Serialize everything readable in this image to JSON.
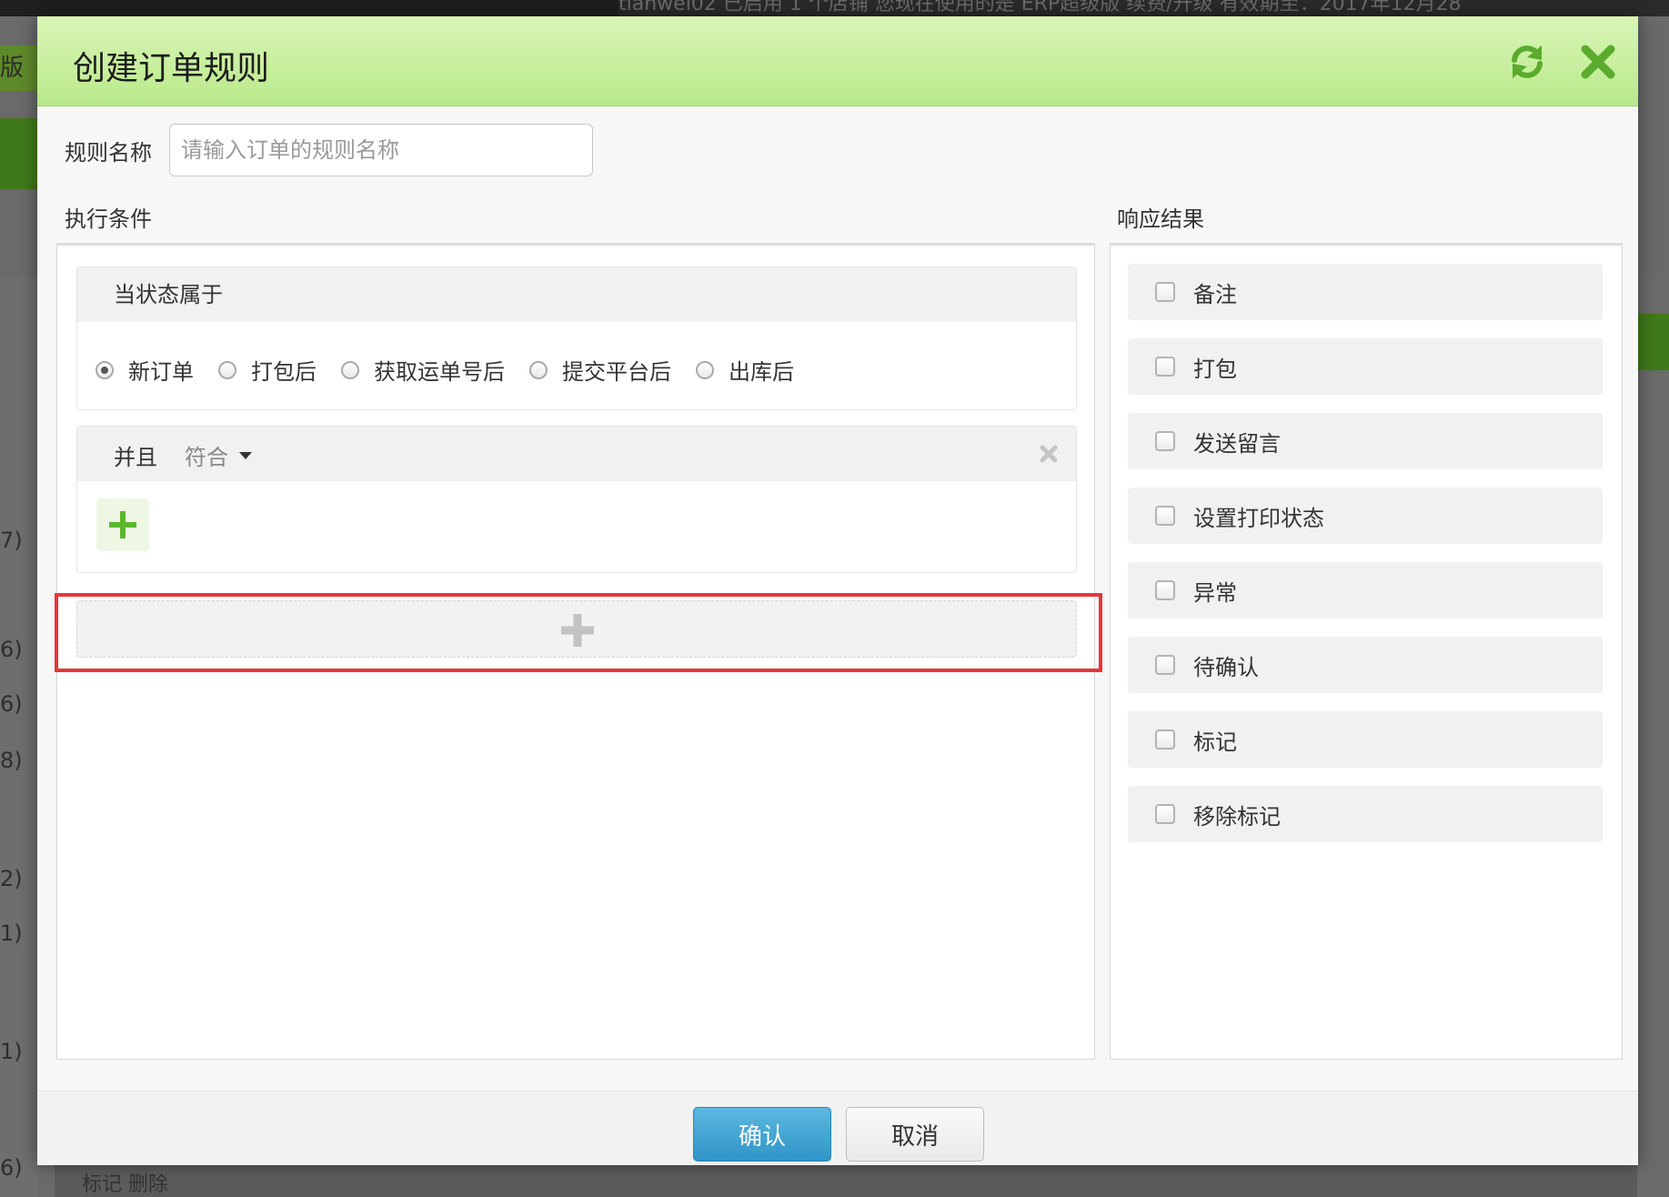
{
  "background": {
    "topbar_text": "tianwei02   已启用 1 个店铺   您现在使用的是 ERP超级版  续费/升级  有效期至：2017年12月28",
    "left_fragment": "版",
    "left_counts": [
      "7)",
      "6)",
      "6)",
      "8)",
      "2)",
      "1)",
      "1)",
      "6)"
    ],
    "bottom_text": "标记   删除"
  },
  "modal": {
    "title": "创建订单规则",
    "header_icons": {
      "refresh": "refresh-icon",
      "close": "close-icon"
    },
    "rule_name": {
      "label": "规则名称",
      "placeholder": "请输入订单的规则名称",
      "value": ""
    },
    "conditions": {
      "title": "执行条件",
      "status_block": {
        "heading": "当状态属于",
        "options": [
          {
            "label": "新订单",
            "checked": true
          },
          {
            "label": "打包后",
            "checked": false
          },
          {
            "label": "获取运单号后",
            "checked": false
          },
          {
            "label": "提交平台后",
            "checked": false
          },
          {
            "label": "出库后",
            "checked": false
          }
        ]
      },
      "and_block": {
        "label": "并且",
        "match": "符合"
      }
    },
    "responses": {
      "title": "响应结果",
      "items": [
        "备注",
        "打包",
        "发送留言",
        "设置打印状态",
        "异常",
        "待确认",
        "标记",
        "移除标记"
      ]
    },
    "footer": {
      "confirm": "确认",
      "cancel": "取消"
    },
    "colors": {
      "header_green": "#c6ee9a",
      "accent_blue": "#3a9fd0",
      "highlight_red": "#e8363b",
      "plus_green": "#5bb82c"
    }
  }
}
